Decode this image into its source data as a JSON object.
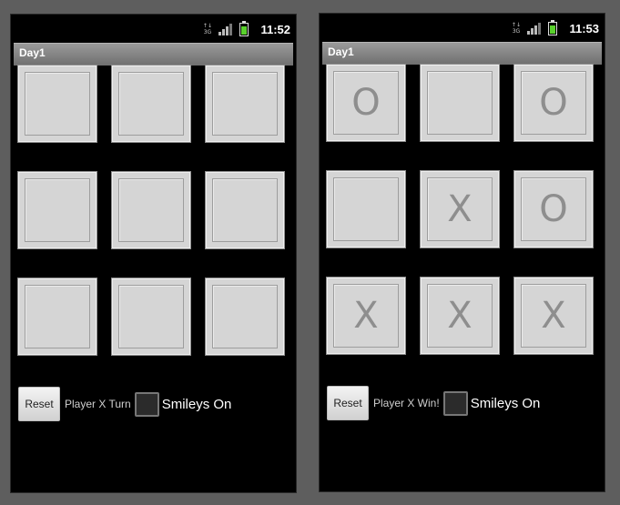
{
  "screens": [
    {
      "clock": "11:52",
      "network_label": "3G",
      "title": "Day1",
      "board": [
        "",
        "",
        "",
        "",
        "",
        "",
        "",
        "",
        ""
      ],
      "reset_label": "Reset",
      "status": "Player X Turn",
      "checkbox_label": "Smileys On"
    },
    {
      "clock": "11:53",
      "network_label": "3G",
      "title": "Day1",
      "board": [
        "O",
        "",
        "O",
        "",
        "X",
        "O",
        "X",
        "X",
        "X"
      ],
      "reset_label": "Reset",
      "status": "Player X Win!",
      "checkbox_label": "Smileys On"
    }
  ],
  "icons": {
    "network": "3g-icon",
    "signal": "signal-strength-icon",
    "battery": "battery-charging-icon"
  },
  "colors": {
    "battery": "#59d12c",
    "cell": "#d5d5d5",
    "mark": "#8e8e8e"
  }
}
